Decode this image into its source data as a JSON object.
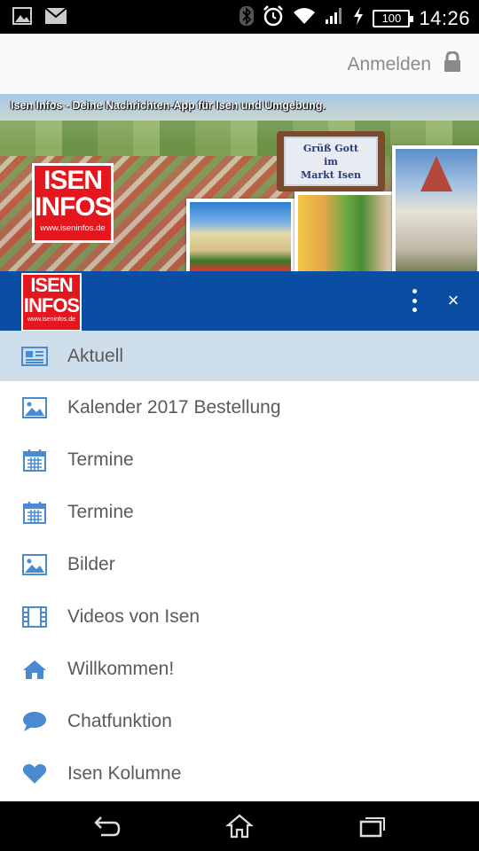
{
  "status_bar": {
    "time": "14:26",
    "battery": "100",
    "icons": [
      "image-icon",
      "mail-icon",
      "bluetooth-icon",
      "alarm-icon",
      "wifi-icon",
      "signal-icon",
      "charging-icon",
      "battery-icon"
    ]
  },
  "app_bar": {
    "login_label": "Anmelden",
    "login_icon": "lock-icon"
  },
  "banner": {
    "caption": "Isen Infos - Deine Nachrichten-App für Isen und Umgebung.",
    "logo": {
      "line1": "ISEN",
      "line2": "INFOS",
      "url": "www.iseninfos.de"
    },
    "sign": {
      "line1": "Grüß Gott",
      "line2": "im",
      "line3": "Markt Isen"
    }
  },
  "drawer": {
    "logo": {
      "line1": "ISEN",
      "line2": "INFOS",
      "url": "www.iseninfos.de"
    },
    "overflow_icon": "more-vert-icon",
    "close_label": "×"
  },
  "menu": {
    "items": [
      {
        "label": "Aktuell",
        "icon": "newspaper-icon",
        "active": true
      },
      {
        "label": "Kalender 2017 Bestellung",
        "icon": "image-icon",
        "active": false
      },
      {
        "label": "Termine",
        "icon": "calendar-icon",
        "active": false
      },
      {
        "label": "Termine",
        "icon": "calendar-icon",
        "active": false
      },
      {
        "label": "Bilder",
        "icon": "image-icon",
        "active": false
      },
      {
        "label": "Videos von Isen",
        "icon": "film-icon",
        "active": false
      },
      {
        "label": "Willkommen!",
        "icon": "home-icon",
        "active": false
      },
      {
        "label": "Chatfunktion",
        "icon": "chat-bubble-icon",
        "active": false
      },
      {
        "label": "Isen Kolumne",
        "icon": "heart-icon",
        "active": false
      }
    ]
  },
  "colors": {
    "accent": "#0a4ea3",
    "logo_red": "#e3171d",
    "icon_blue": "#4a8ad0",
    "active_row": "#cfdeeb",
    "label_gray": "#5a5a5a"
  },
  "nav_bar": {
    "icons": [
      "back-icon",
      "home-icon",
      "recents-icon"
    ]
  }
}
